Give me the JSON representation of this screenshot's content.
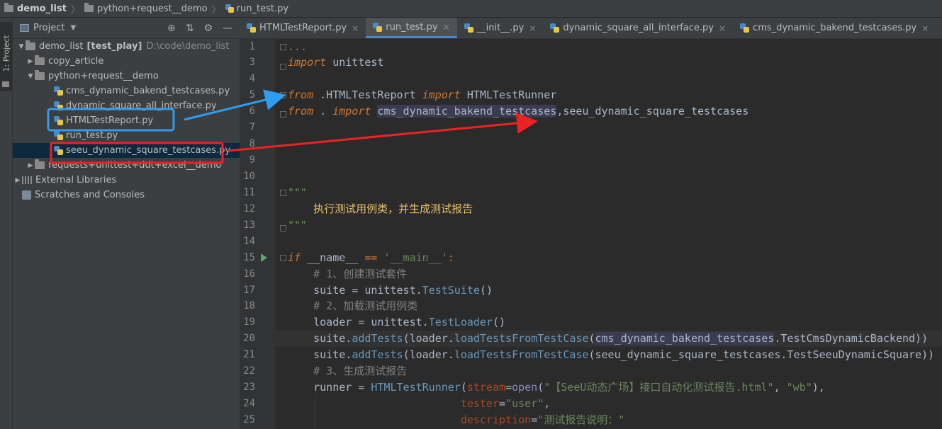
{
  "breadcrumb": [
    "demo_list",
    "python+request__demo",
    "run_test.py"
  ],
  "stripe": {
    "label": "1: Project"
  },
  "project_panel": {
    "title": "Project",
    "tools": [
      "⊕",
      "⇅",
      "⚙",
      "—"
    ],
    "tree": [
      {
        "label": "demo_list",
        "bold": "[test_play]",
        "path": "D:\\code\\demo_list"
      },
      {
        "label": "copy_article"
      },
      {
        "label": "python+request__demo"
      },
      {
        "label": "cms_dynamic_bakend_testcases.py"
      },
      {
        "label": "dynamic_square_all_interface.py"
      },
      {
        "label": "HTMLTestReport.py"
      },
      {
        "label": "run_test.py"
      },
      {
        "label": "seeu_dynamic_square_testcases.py"
      },
      {
        "label": "requests+unittest+ddt+excel__demo"
      },
      {
        "label": "External Libraries"
      },
      {
        "label": "Scratches and Consoles"
      }
    ]
  },
  "tabs": [
    {
      "label": "HTMLTestReport.py"
    },
    {
      "label": "run_test.py"
    },
    {
      "label": "__init__.py"
    },
    {
      "label": "dynamic_square_all_interface.py"
    },
    {
      "label": "cms_dynamic_bakend_testcases.py"
    }
  ],
  "line_numbers": [
    "1",
    "3",
    "4",
    "5",
    "6",
    "7",
    "8",
    "9",
    "10",
    "11",
    "12",
    "13",
    "14",
    "15",
    "16",
    "17",
    "18",
    "19",
    "20",
    "21",
    "22",
    "23",
    "24",
    "25"
  ],
  "code": {
    "l1": "...",
    "l3_kw": "import",
    "l3_rest": " unittest",
    "l5_kw1": "from",
    "l5_mid": " .HTMLTestReport ",
    "l5_kw2": "import",
    "l5_rest": " HTMLTestRunner",
    "l6_kw1": "from",
    "l6_mid": " . ",
    "l6_kw2": "import",
    "l6_sp": " ",
    "l6_hl": "cms_dynamic_bakend_testcases",
    "l6_rest": ",seeu_dynamic_square_testcases",
    "l11": "\"\"\"",
    "l12": "    执行测试用例类，并生成测试报告",
    "l13": "\"\"\"",
    "l15_kw": "if",
    "l15_a": " __name__ ",
    "l15_op": "==",
    "l15_sp": " ",
    "l15_str": "'__main__'",
    "l15_c": ":",
    "l16": "    # 1、创建测试套件",
    "l17_a": "    suite = unittest.",
    "l17_fn": "TestSuite",
    "l17_b": "()",
    "l18": "    # 2、加载测试用例类",
    "l19_a": "    loader = unittest.",
    "l19_fn": "TestLoader",
    "l19_b": "()",
    "l20_a": "    suite.",
    "l20_fn1": "addTests",
    "l20_b": "(loader.",
    "l20_fn2": "loadTestsFromTestCase",
    "l20_c": "(",
    "l20_hl": "cms_dynamic_bakend_testcases",
    "l20_d": ".TestCmsDynamicBackend))",
    "l21_a": "    suite.",
    "l21_fn1": "addTests",
    "l21_b": "(loader.",
    "l21_fn2": "loadTestsFromTestCase",
    "l21_c": "(seeu_dynamic_square_testcases.TestSeeuDynamicSquare))",
    "l22": "    # 3、生成测试报告",
    "l23_a": "    runner = ",
    "l23_fn": "HTMLTestRunner",
    "l23_b": "(",
    "l23_p": "stream",
    "l23_eq": "=",
    "l23_open": "open",
    "l23_c": "(",
    "l23_s1": "\"【SeeU动态广场】接口自动化测试报告.html\"",
    "l23_d": ", ",
    "l23_s2": "\"wb\"",
    "l23_e": "),",
    "l24_a": "                           ",
    "l24_p": "tester",
    "l24_eq": "=",
    "l24_s": "\"user\"",
    "l24_c": ",",
    "l25_a": "                           ",
    "l25_p": "description",
    "l25_eq": "=",
    "l25_s": "\"测试报告说明：\""
  }
}
